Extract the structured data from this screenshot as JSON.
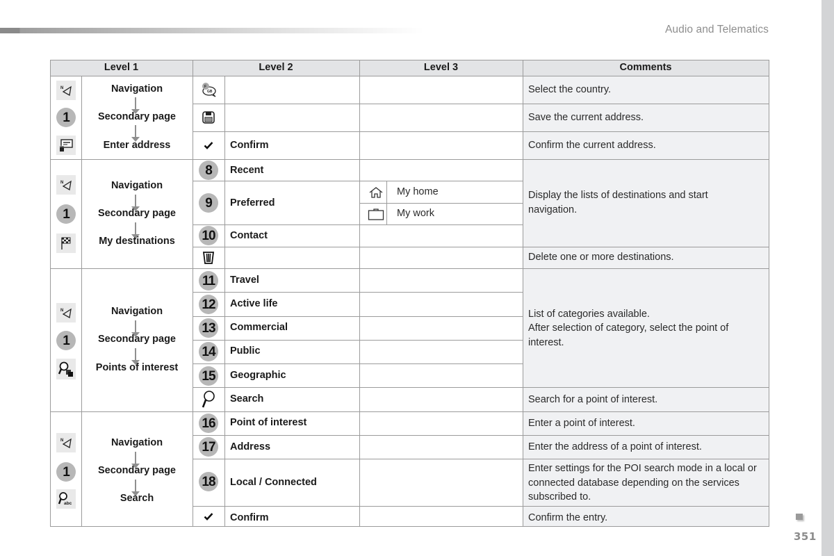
{
  "header": {
    "section_title": "Audio and Telematics",
    "page_number": "351"
  },
  "table": {
    "columns": [
      "Level 1",
      "Level 2",
      "Level 3",
      "Comments"
    ],
    "groups": [
      {
        "level1": {
          "icons": [
            "navigation-north-icon",
            "secondary-page-badge-1",
            "enter-address-icon"
          ],
          "badge": "1",
          "path": [
            "Navigation",
            "Secondary page",
            "Enter address"
          ]
        },
        "rows": [
          {
            "level2_icon": "country-flag-bubble-icon",
            "level2_label": "",
            "level3": "",
            "comment": "Select the country."
          },
          {
            "level2_icon": "floppy-save-icon",
            "level2_label": "",
            "level3": "",
            "comment": "Save the current address."
          },
          {
            "level2_icon": "checkmark-icon",
            "level2_label": "Confirm",
            "level3": "",
            "comment": "Confirm the current address."
          }
        ]
      },
      {
        "level1": {
          "icons": [
            "navigation-north-icon",
            "secondary-page-badge-1",
            "checkered-flag-icon"
          ],
          "badge": "1",
          "path": [
            "Navigation",
            "Secondary page",
            "My destinations"
          ]
        },
        "rows": [
          {
            "level2_badge": "8",
            "level2_label": "Recent",
            "level3": ""
          },
          {
            "level2_badge": "9",
            "level2_label": "Preferred",
            "level3_items": [
              {
                "icon": "home-icon",
                "label": "My home"
              },
              {
                "icon": "briefcase-icon",
                "label": "My work"
              }
            ]
          },
          {
            "level2_badge": "10",
            "level2_label": "Contact",
            "level3": ""
          },
          {
            "level2_icon": "trash-icon",
            "level2_label": "",
            "level3": "",
            "comment": "Delete one or more destinations."
          }
        ],
        "shared_comment": "Display the lists of destinations and start navigation."
      },
      {
        "level1": {
          "icons": [
            "navigation-north-icon",
            "secondary-page-badge-1",
            "poi-search-icon"
          ],
          "badge": "1",
          "path": [
            "Navigation",
            "Secondary page",
            "Points of interest"
          ]
        },
        "rows": [
          {
            "level2_badge": "11",
            "level2_label": "Travel"
          },
          {
            "level2_badge": "12",
            "level2_label": "Active life"
          },
          {
            "level2_badge": "13",
            "level2_label": "Commercial"
          },
          {
            "level2_badge": "14",
            "level2_label": "Public"
          },
          {
            "level2_badge": "15",
            "level2_label": "Geographic"
          },
          {
            "level2_icon": "magnifier-icon",
            "level2_label": "Search",
            "comment": "Search for a point of interest."
          }
        ],
        "shared_comment_lines": [
          "List of categories available.",
          "After selection of category, select the point of interest."
        ]
      },
      {
        "level1": {
          "icons": [
            "navigation-north-icon",
            "secondary-page-badge-1",
            "text-search-icon"
          ],
          "badge": "1",
          "path": [
            "Navigation",
            "Secondary page",
            "Search"
          ]
        },
        "rows": [
          {
            "level2_badge": "16",
            "level2_label": "Point of interest",
            "comment": "Enter a point of interest."
          },
          {
            "level2_badge": "17",
            "level2_label": "Address",
            "comment": "Enter the address of a point of interest."
          },
          {
            "level2_badge": "18",
            "level2_label": "Local / Connected",
            "comment": "Enter settings for the POI search mode in a local or connected database depending on the services subscribed to."
          },
          {
            "level2_icon": "checkmark-icon",
            "level2_label": "Confirm",
            "comment": "Confirm the entry."
          }
        ]
      }
    ]
  },
  "colors": {
    "header_bg": "#e3e4e6",
    "comments_bg": "#f0f1f3",
    "badge_bg": "#b7b7b7",
    "grid": "#9b9b9b",
    "side_strip": "#d3d4d6"
  }
}
